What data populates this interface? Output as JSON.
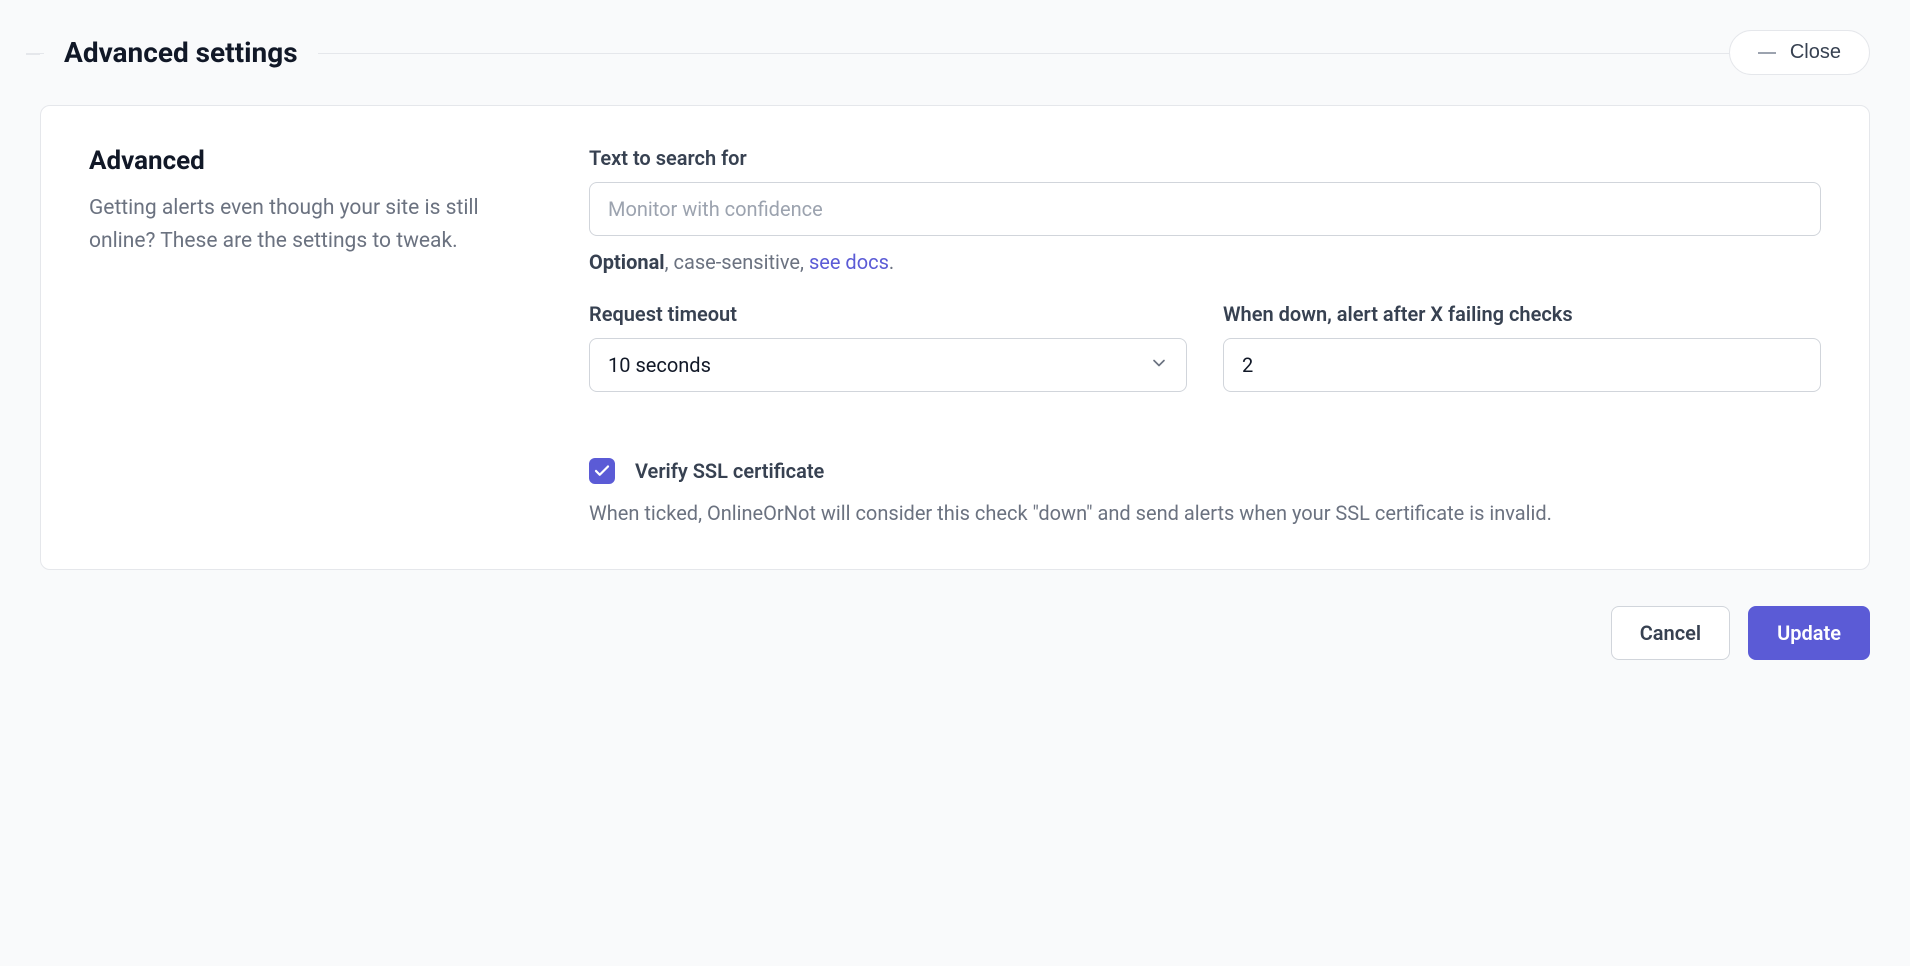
{
  "section": {
    "title": "Advanced settings",
    "close_label": "Close"
  },
  "card": {
    "title": "Advanced",
    "description": "Getting alerts even though your site is still online? These are the settings to tweak."
  },
  "form": {
    "text_search": {
      "label": "Text to search for",
      "placeholder": "Monitor with confidence",
      "value": "",
      "help_bold": "Optional",
      "help_rest": ", case-sensitive, ",
      "help_link": "see docs",
      "help_end": "."
    },
    "request_timeout": {
      "label": "Request timeout",
      "value": "10 seconds"
    },
    "alert_after": {
      "label": "When down, alert after X failing checks",
      "value": "2"
    },
    "verify_ssl": {
      "label": "Verify SSL certificate",
      "checked": true,
      "help": "When ticked, OnlineOrNot will consider this check \"down\" and send alerts when your SSL certificate is invalid."
    }
  },
  "actions": {
    "cancel": "Cancel",
    "update": "Update"
  }
}
